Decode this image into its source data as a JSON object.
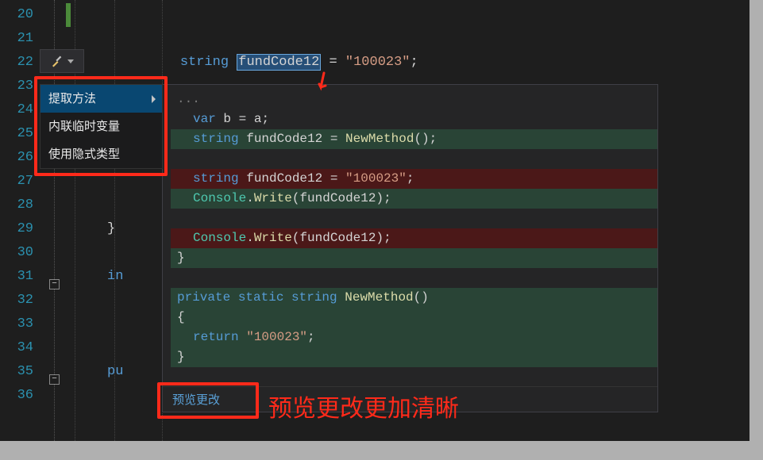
{
  "gutter": {
    "lines": [
      "20",
      "21",
      "22",
      "23",
      "24",
      "25",
      "26",
      "27",
      "28",
      "29",
      "30",
      "31",
      "32",
      "33",
      "34",
      "35",
      "36"
    ]
  },
  "code": {
    "line22_kw": "string",
    "line22_sel": "fundCode12",
    "line22_op": " = ",
    "line22_str": "\"100023\"",
    "line22_end": ";",
    "line31_kw": "in",
    "line35_kw": "pu"
  },
  "action_icon": "screwdriver-icon",
  "menu": {
    "items": [
      {
        "label": "提取方法",
        "selected": true,
        "hasSubmenu": true
      },
      {
        "label": "内联临时变量",
        "selected": false,
        "hasSubmenu": false
      },
      {
        "label": "使用隐式类型",
        "selected": false,
        "hasSubmenu": false
      }
    ]
  },
  "preview": {
    "lines": [
      {
        "cls": "",
        "parts": [
          {
            "t": "...",
            "c": "p-dim"
          }
        ]
      },
      {
        "cls": "p-indent1",
        "parts": [
          {
            "t": "var ",
            "c": "p-kw"
          },
          {
            "t": "b",
            "c": "p-plain"
          },
          {
            "t": " = ",
            "c": "p-plain"
          },
          {
            "t": "a",
            "c": "p-plain"
          },
          {
            "t": ";",
            "c": "p-plain"
          }
        ]
      },
      {
        "cls": "add p-indent1",
        "parts": [
          {
            "t": "string ",
            "c": "p-kw"
          },
          {
            "t": "fundCode12",
            "c": "p-plain"
          },
          {
            "t": " = ",
            "c": "p-plain"
          },
          {
            "t": "NewMethod",
            "c": "p-method"
          },
          {
            "t": "();",
            "c": "p-plain"
          }
        ]
      },
      {
        "cls": "",
        "parts": [
          {
            "t": " ",
            "c": "p-plain"
          }
        ]
      },
      {
        "cls": "del p-indent1",
        "parts": [
          {
            "t": "string ",
            "c": "p-kw"
          },
          {
            "t": "fundCode12",
            "c": "p-plain"
          },
          {
            "t": " = ",
            "c": "p-plain"
          },
          {
            "t": "\"100023\"",
            "c": "p-str"
          },
          {
            "t": ";",
            "c": "p-plain"
          }
        ]
      },
      {
        "cls": "add p-indent1",
        "parts": [
          {
            "t": "Console",
            "c": "p-type"
          },
          {
            "t": ".",
            "c": "p-plain"
          },
          {
            "t": "Write",
            "c": "p-method"
          },
          {
            "t": "(",
            "c": "p-plain"
          },
          {
            "t": "fundCode12",
            "c": "p-plain"
          },
          {
            "t": ");",
            "c": "p-plain"
          }
        ]
      },
      {
        "cls": "",
        "parts": [
          {
            "t": " ",
            "c": "p-plain"
          }
        ]
      },
      {
        "cls": "del p-indent1",
        "parts": [
          {
            "t": "Console",
            "c": "p-type"
          },
          {
            "t": ".",
            "c": "p-plain"
          },
          {
            "t": "Write",
            "c": "p-method"
          },
          {
            "t": "(",
            "c": "p-plain"
          },
          {
            "t": "fundCode12",
            "c": "p-plain"
          },
          {
            "t": ");",
            "c": "p-plain"
          }
        ]
      },
      {
        "cls": "brace",
        "parts": [
          {
            "t": "}",
            "c": "p-plain"
          }
        ]
      },
      {
        "cls": "",
        "parts": [
          {
            "t": " ",
            "c": "p-plain"
          }
        ]
      },
      {
        "cls": "add",
        "parts": [
          {
            "t": "private static string ",
            "c": "p-kw"
          },
          {
            "t": "NewMethod",
            "c": "p-method"
          },
          {
            "t": "()",
            "c": "p-plain"
          }
        ]
      },
      {
        "cls": "brace",
        "parts": [
          {
            "t": "{",
            "c": "p-plain"
          }
        ]
      },
      {
        "cls": "add p-indent1",
        "parts": [
          {
            "t": "return ",
            "c": "p-kw"
          },
          {
            "t": "\"100023\"",
            "c": "p-str"
          },
          {
            "t": ";",
            "c": "p-plain"
          }
        ]
      },
      {
        "cls": "brace",
        "parts": [
          {
            "t": "}",
            "c": "p-plain"
          }
        ]
      }
    ],
    "footer_link": "预览更改"
  },
  "annotation": {
    "text": "预览更改更加清晰"
  }
}
